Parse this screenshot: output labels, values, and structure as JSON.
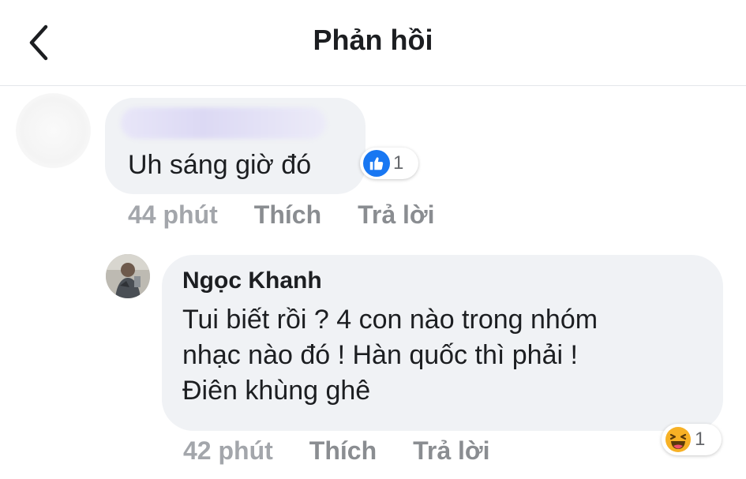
{
  "header": {
    "title": "Phản hồi",
    "back_icon": "chevron-left-icon"
  },
  "comments": [
    {
      "author": "",
      "author_blurred": true,
      "text": "Uh sáng giờ đó",
      "reaction": {
        "icon": "like-icon",
        "count": "1",
        "color": "#1877f2"
      },
      "time": "44 phút",
      "like_label": "Thích",
      "reply_label": "Trả lời"
    },
    {
      "author": "Ngọc Khanh",
      "text_lines": [
        "Tui biết rồi ? 4 con nào trong nhóm",
        "nhạc nào đó ! Hàn quốc thì phải !",
        "Điên khùng ghê"
      ],
      "reaction": {
        "icon": "haha-icon",
        "count": "1",
        "color": "#f7b125"
      },
      "time": "42 phút",
      "like_label": "Thích",
      "reply_label": "Trả lời"
    }
  ],
  "colors": {
    "bubble_bg": "#f0f2f5",
    "text": "#1c1e21",
    "muted": "#8a8d91",
    "like_blue": "#1877f2"
  }
}
